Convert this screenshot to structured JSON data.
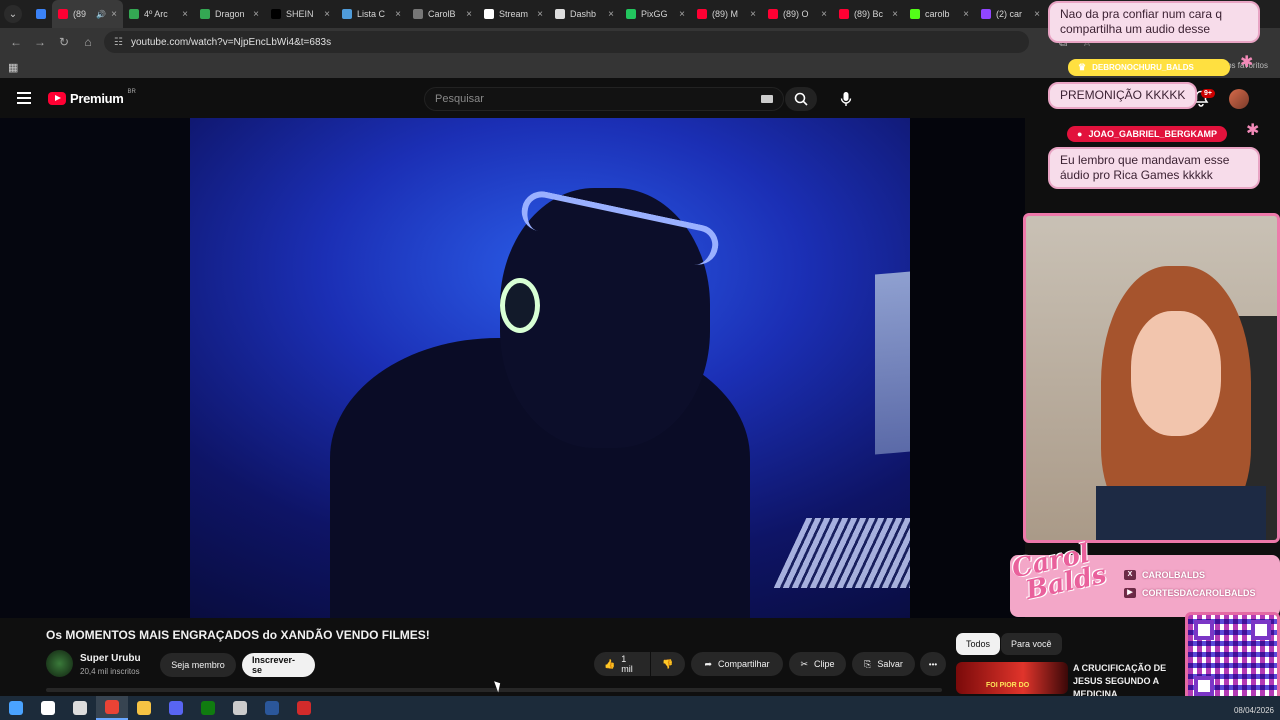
{
  "browser": {
    "tabs": [
      {
        "label": "",
        "color": "#3b82f6",
        "pinned": true
      },
      {
        "label": "(89",
        "color": "#ff0033",
        "active": true
      },
      {
        "label": "4º Arc",
        "color": "#34a853"
      },
      {
        "label": "Dragon",
        "color": "#34a853"
      },
      {
        "label": "SHEIN",
        "color": "#000000",
        "glyph": "S"
      },
      {
        "label": "Lista C",
        "color": "#4f9bd9"
      },
      {
        "label": "CarolB",
        "color": "#777777"
      },
      {
        "label": "Stream",
        "color": "#ffffff"
      },
      {
        "label": "Dashb",
        "color": "#dddddd"
      },
      {
        "label": "PixGG",
        "color": "#22c55e"
      },
      {
        "label": "(89) M",
        "color": "#ff0033"
      },
      {
        "label": "(89) O",
        "color": "#ff0033"
      },
      {
        "label": "(89) Bc",
        "color": "#ff0033"
      },
      {
        "label": "carolb",
        "color": "#53fc18"
      },
      {
        "label": "(2) car",
        "color": "#9146ff"
      }
    ],
    "url": "youtube.com/watch?v=NjpEncLbWi4&t=683s",
    "bookmarks_right": "os favoritos"
  },
  "youtube": {
    "logo_text": "Premium",
    "logo_region": "BR",
    "search_placeholder": "Pesquisar",
    "notifications_badge": "9+",
    "video_title": "Os MOMENTOS MAIS ENGRAÇADOS do XANDÃO VENDO FILMES!",
    "channel_name": "Super Urubu",
    "channel_subs": "20,4 mil inscritos",
    "member_label": "Seja membro",
    "subscribe_label": "Inscrever-se",
    "likes": "1 mil",
    "share_label": "Compartilhar",
    "clip_label": "Clipe",
    "save_label": "Salvar",
    "more_label": "•••",
    "chips": [
      "Todos",
      "Para você"
    ],
    "recommended_title": "A CRUCIFICAÇÃO DE JESUS SEGUNDO A MEDICINA",
    "recommended_thumb_text": "FOI PIOR DO"
  },
  "overlay": {
    "chat": [
      {
        "user": "",
        "message": "Nao da pra confiar num cara q compartilha um audio desse"
      },
      {
        "user": "DEBRONOCHURU_BALDS",
        "message": "PREMONIÇÃO KKKKK"
      },
      {
        "user": "JOAO_GABRIEL_BERGKAMP",
        "message": "Eu lembro que mandavam esse áudio pro Rica Games kkkkk"
      }
    ],
    "brand_script": "Carol Balds",
    "socials": [
      "CAROLBALDS",
      "CORTESDACAROLBALDS"
    ],
    "social_icons": [
      "X",
      "▶"
    ]
  },
  "taskbar": {
    "date": "08/04/2026",
    "apps": [
      {
        "name": "windows-start-icon",
        "color": "#4aa3ff"
      },
      {
        "name": "search-icon",
        "color": "#ffffff"
      },
      {
        "name": "task-view-icon",
        "color": "#dddddd"
      },
      {
        "name": "chrome-icon",
        "color": "#ea4335",
        "active": true
      },
      {
        "name": "file-explorer-icon",
        "color": "#f6c344"
      },
      {
        "name": "discord-icon",
        "color": "#5865f2"
      },
      {
        "name": "xbox-icon",
        "color": "#107c10"
      },
      {
        "name": "shield-icon",
        "color": "#cccccc"
      },
      {
        "name": "word-icon",
        "color": "#2b579a"
      },
      {
        "name": "obs-icon",
        "color": "#d22b2b"
      }
    ]
  },
  "colors": {
    "accent_red": "#ff0033",
    "overlay_pink": "#ee79aa",
    "chat_bubble_bg": "#f7dcea"
  }
}
